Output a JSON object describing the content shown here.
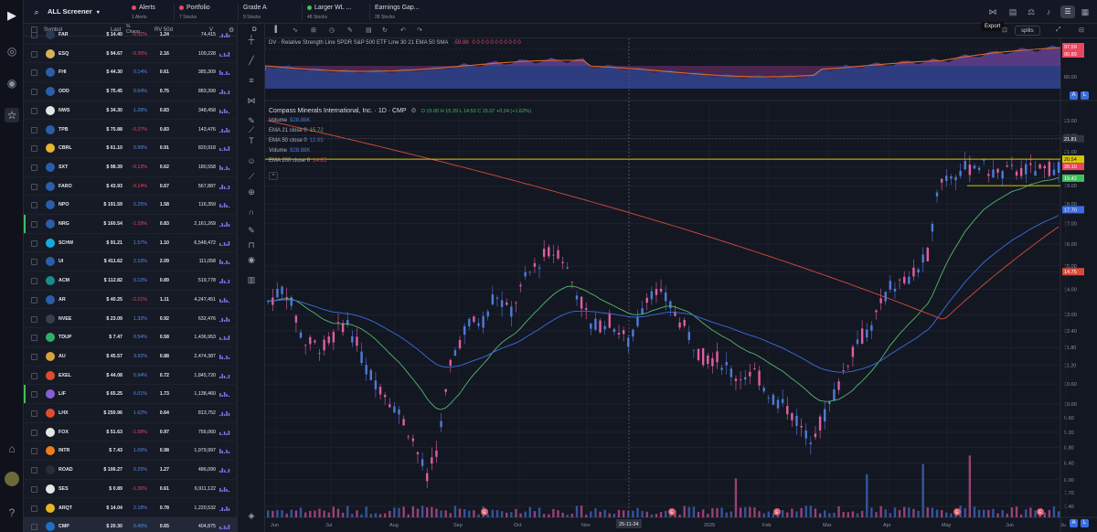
{
  "app": {
    "logo": "play-logo-icon"
  },
  "topbar": {
    "search_icon": "search-icon",
    "screener_title": "ALL Screener",
    "tabs": [
      {
        "name": "Alerts",
        "sub": "1 Alerts",
        "dot": "#e8475f"
      },
      {
        "name": "Portfolio",
        "sub": "7 Stocks",
        "dot": "#e8475f"
      },
      {
        "name": "Grade A",
        "sub": "9 Stocks",
        "dot": ""
      },
      {
        "name": "Larger WL ...",
        "sub": "48 Stocks",
        "dot": "#3fbf5b"
      },
      {
        "name": "Earnings Gap...",
        "sub": "28 Stocks",
        "dot": ""
      }
    ],
    "export_label": "Export",
    "splits_label": "splits"
  },
  "screener": {
    "columns": [
      "Symbol",
      "Last",
      "% Chang...",
      "RV 50d",
      "V"
    ],
    "rows": [
      {
        "symbol": "FAR",
        "last": "$ 14.40",
        "change": "-0.11%",
        "rv": "1.24",
        "volume": "74,415",
        "logo": "#2b3a55",
        "up": false
      },
      {
        "symbol": "ESQ",
        "last": "$ 94.67",
        "change": "-0.35%",
        "rv": "2.16",
        "volume": "109,228",
        "logo": "#d6b35a",
        "up": false
      },
      {
        "symbol": "FHI",
        "last": "$ 44.30",
        "change": "0.14%",
        "rv": "0.61",
        "volume": "385,309",
        "logo": "#2b5ea8",
        "up": true
      },
      {
        "symbol": "ODD",
        "last": "$ 75.45",
        "change": "0.64%",
        "rv": "0.75",
        "volume": "883,399",
        "logo": "#2b5ea8",
        "up": true
      },
      {
        "symbol": "NWS",
        "last": "$ 34.30",
        "change": "1.28%",
        "rv": "0.83",
        "volume": "348,458",
        "logo": "#e6e6e6",
        "up": true
      },
      {
        "symbol": "TPB",
        "last": "$ 75.88",
        "change": "-0.37%",
        "rv": "0.83",
        "volume": "143,476",
        "logo": "#2b5ea8",
        "up": false
      },
      {
        "symbol": "CBRL",
        "last": "$ 61.10",
        "change": "0.99%",
        "rv": "0.91",
        "volume": "820,918",
        "logo": "#e8b531",
        "up": true
      },
      {
        "symbol": "SXT",
        "last": "$ 98.39",
        "change": "-0.13%",
        "rv": "0.62",
        "volume": "180,558",
        "logo": "#2b5ea8",
        "up": false
      },
      {
        "symbol": "FARO",
        "last": "$ 43.93",
        "change": "-0.14%",
        "rv": "0.67",
        "volume": "567,887",
        "logo": "#2b5ea8",
        "up": false
      },
      {
        "symbol": "NPO",
        "last": "$ 191.59",
        "change": "0.25%",
        "rv": "1.58",
        "volume": "116,359",
        "logo": "#2b5ea8",
        "up": true
      },
      {
        "symbol": "NRG",
        "last": "$ 160.54",
        "change": "-1.29%",
        "rv": "0.83",
        "volume": "2,161,269",
        "logo": "#2b5ea8",
        "up": false
      },
      {
        "symbol": "SCHW",
        "last": "$ 91.21",
        "change": "1.57%",
        "rv": "1.10",
        "volume": "6,548,472",
        "logo": "#19a7e0",
        "up": true
      },
      {
        "symbol": "UI",
        "last": "$ 411.62",
        "change": "2.19%",
        "rv": "2.09",
        "volume": "111,058",
        "logo": "#2b5ea8",
        "up": true
      },
      {
        "symbol": "ACM",
        "last": "$ 112.82",
        "change": "0.13%",
        "rv": "0.89",
        "volume": "519,778",
        "logo": "#1b8c8c",
        "up": true
      },
      {
        "symbol": "AR",
        "last": "$ 40.25",
        "change": "-2.21%",
        "rv": "1.11",
        "volume": "4,247,451",
        "logo": "#2b5ea8",
        "up": false
      },
      {
        "symbol": "NVEE",
        "last": "$ 23.09",
        "change": "1.32%",
        "rv": "0.92",
        "volume": "632,476",
        "logo": "#3a3f4d",
        "up": true
      },
      {
        "symbol": "TDUP",
        "last": "$ 7.47",
        "change": "0.54%",
        "rv": "0.58",
        "volume": "1,436,953",
        "logo": "#2fae6a",
        "up": true
      },
      {
        "symbol": "AU",
        "last": "$ 45.57",
        "change": "3.92%",
        "rv": "0.88",
        "volume": "2,474,387",
        "logo": "#d6a43a",
        "up": true
      },
      {
        "symbol": "EXEL",
        "last": "$ 44.08",
        "change": "0.94%",
        "rv": "0.72",
        "volume": "1,845,720",
        "logo": "#e04d2d",
        "up": true
      },
      {
        "symbol": "LIF",
        "last": "$ 65.25",
        "change": "5.01%",
        "rv": "1.73",
        "volume": "1,138,460",
        "logo": "#8a5cd6",
        "up": true
      },
      {
        "symbol": "LHX",
        "last": "$ 250.96",
        "change": "1.62%",
        "rv": "0.64",
        "volume": "813,752",
        "logo": "#e04d2d",
        "up": true
      },
      {
        "symbol": "FOX",
        "last": "$ 51.63",
        "change": "-1.58%",
        "rv": "0.97",
        "volume": "756,060",
        "logo": "#e6e6e6",
        "up": false
      },
      {
        "symbol": "INTR",
        "last": "$ 7.43",
        "change": "1.09%",
        "rv": "0.98",
        "volume": "1,979,997",
        "logo": "#f07c1b",
        "up": true
      },
      {
        "symbol": "ROAD",
        "last": "$ 106.27",
        "change": "0.25%",
        "rv": "1.27",
        "volume": "486,090",
        "logo": "#2a2d36",
        "up": true
      },
      {
        "symbol": "SES",
        "last": "$ 0.89",
        "change": "-1.36%",
        "rv": "0.61",
        "volume": "6,911,122",
        "logo": "#e6e6e6",
        "up": false
      },
      {
        "symbol": "ARQT",
        "last": "$ 14.04",
        "change": "2.18%",
        "rv": "0.78",
        "volume": "1,220,532",
        "logo": "#e6b524",
        "up": true
      },
      {
        "symbol": "CMP",
        "last": "$ 20.30",
        "change": "0.40%",
        "rv": "0.65",
        "volume": "404,875",
        "logo": "#1f6fc5",
        "up": true
      }
    ]
  },
  "chart": {
    "rs_legend": "DV · Relative Strength Line SPDR S&P 500 ETF Line 30 21 EMA 50 SMA",
    "rs_value": "-59.88",
    "rs_zeros": "0 0 0 0 0 0 0 0 0 0 0",
    "rs_scale": [
      "97.59",
      "90.89",
      "60.00"
    ],
    "title": "Compass Minerals International, Inc. · 1D · CMP",
    "ohlc": "O 15.00  H 15.29  L 14.52  C 15.07  +0.24 (+1.62%)",
    "indicators": [
      {
        "name": "Volume",
        "value": "928.88K",
        "color": "#4f7bd9"
      },
      {
        "name": "EMA 21 close 0",
        "value": "15.72",
        "color": "#55b86b"
      },
      {
        "name": "EMA 50 close 0",
        "value": "12.85",
        "color": "#3c6de0"
      },
      {
        "name": "Volume",
        "value": "928.88K",
        "color": "#4f7bd9"
      },
      {
        "name": "EMA 200 close 0",
        "value": "14.85",
        "color": "#d84a3a"
      }
    ],
    "price_axis": [
      "23.00",
      "22.00",
      "21.81",
      "21.00",
      "20.54",
      "20.10",
      "19.42",
      "19.00",
      "18.00",
      "17.70",
      "17.00",
      "16.00",
      "15.00",
      "14.75",
      "14.00",
      "13.00",
      "12.40",
      "11.80",
      "11.20",
      "10.60",
      "10.00",
      "9.60",
      "9.20",
      "8.80",
      "8.40",
      "8.00",
      "7.70",
      "7.40"
    ],
    "tags": [
      {
        "value": "21.81",
        "color": "#2f3442"
      },
      {
        "value": "20.54",
        "color": "#d8c400"
      },
      {
        "value": "20.10",
        "color": "#e8475f"
      },
      {
        "value": "19.42",
        "color": "#3fbf5b"
      },
      {
        "value": "17.70",
        "color": "#3c6de0"
      },
      {
        "value": "14.75",
        "color": "#d84a3a"
      }
    ],
    "months": [
      "Jun",
      "Jul",
      "Aug",
      "Sep",
      "Oct",
      "Nov",
      "25-11-24",
      "2025",
      "Feb",
      "Mar",
      "Apr",
      "May",
      "Jun",
      "Ju"
    ],
    "crosshair_date": "25-11-24",
    "earnings_marker": "E"
  }
}
